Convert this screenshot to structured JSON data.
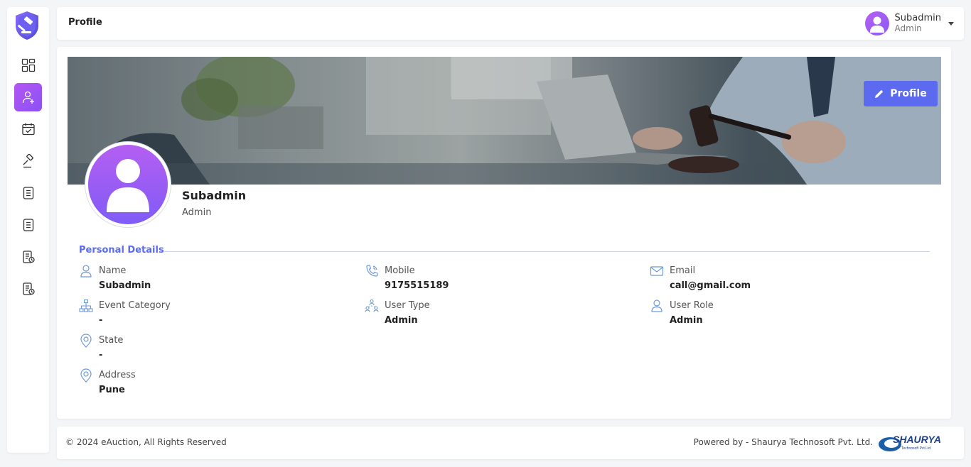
{
  "header": {
    "page_title": "Profile",
    "user_name": "Subadmin",
    "user_role": "Admin"
  },
  "profile": {
    "edit_button_label": "Profile",
    "name": "Subadmin",
    "role": "Admin"
  },
  "personal_details": {
    "section_title": "Personal Details",
    "fields": [
      {
        "label": "Name",
        "value": "Subadmin",
        "icon": "user-icon"
      },
      {
        "label": "Mobile",
        "value": "9175515189",
        "icon": "phone-icon"
      },
      {
        "label": "Email",
        "value": "call@gmail.com",
        "icon": "mail-icon"
      },
      {
        "label": "Event Category",
        "value": "-",
        "icon": "hierarchy-icon"
      },
      {
        "label": "User Type",
        "value": "Admin",
        "icon": "users-network-icon"
      },
      {
        "label": "User Role",
        "value": "Admin",
        "icon": "user-icon"
      },
      {
        "label": "State",
        "value": "-",
        "icon": "location-pin-icon"
      },
      {
        "label": "Address",
        "value": "Pune",
        "icon": "location-pin-icon"
      }
    ]
  },
  "sidebar": {
    "items": [
      {
        "icon": "dashboard-icon"
      },
      {
        "icon": "user-add-icon",
        "active": true
      },
      {
        "icon": "calendar-check-icon"
      },
      {
        "icon": "auction-hammer-icon"
      },
      {
        "icon": "list-document-icon"
      },
      {
        "icon": "list-document-icon"
      },
      {
        "icon": "report-document-icon"
      },
      {
        "icon": "report-document-icon"
      }
    ]
  },
  "footer": {
    "copyright": "© 2024 eAuction, All Rights Reserved",
    "powered_by": "Powered by - Shaurya Technosoft Pvt. Ltd.",
    "brand_name": "SHAURYA",
    "brand_sub": "Technosoft Pvt Ltd"
  },
  "colors": {
    "accent": "#5c6af0",
    "gradient_start": "#b55ef2",
    "gradient_end": "#7f5cf6",
    "icon_blue": "#6e9bd6"
  }
}
